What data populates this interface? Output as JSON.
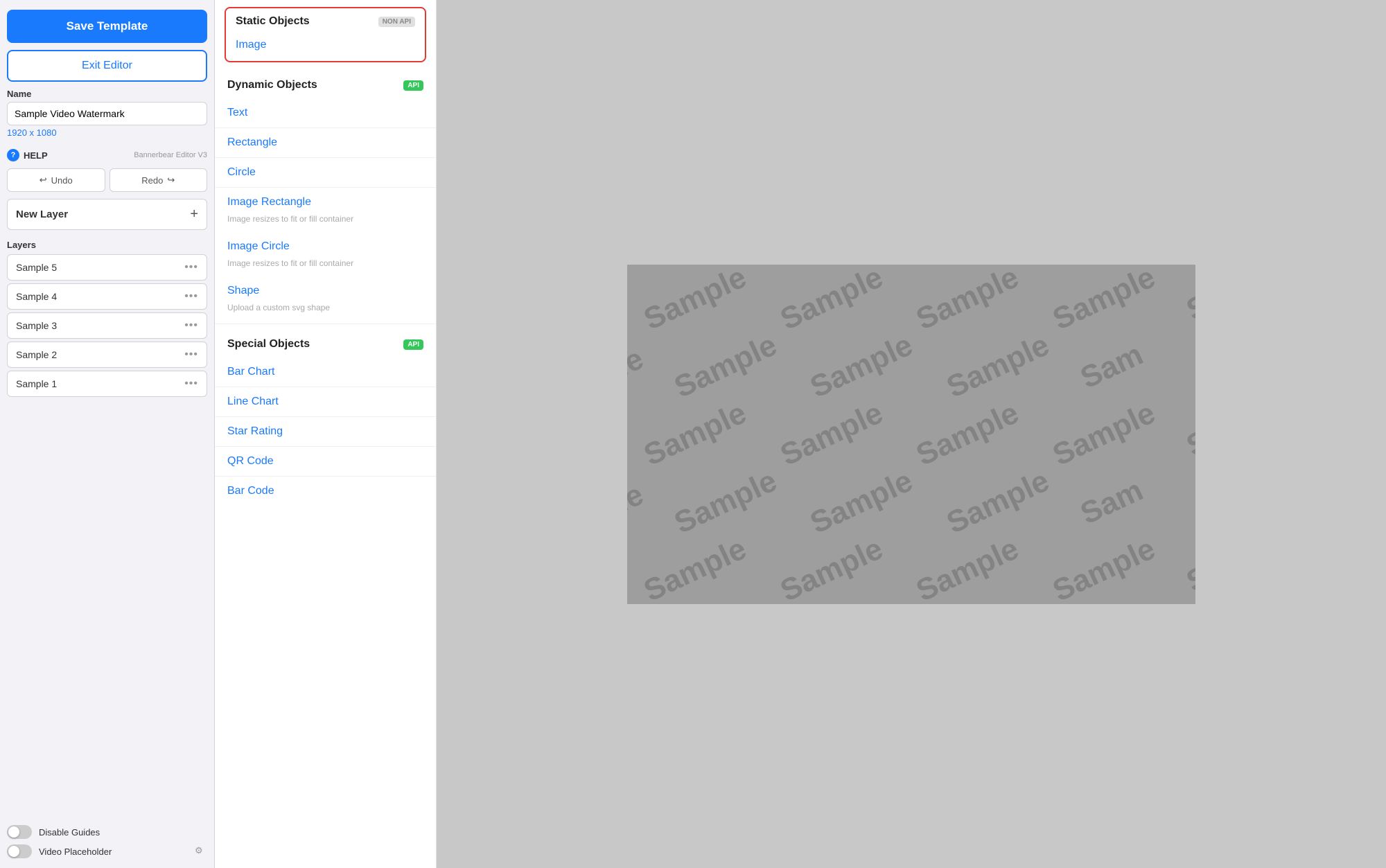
{
  "sidebar": {
    "save_button": "Save Template",
    "exit_button": "Exit Editor",
    "name_label": "Name",
    "name_value": "Sample Video Watermark",
    "dimensions": "1920 x 1080",
    "help_label": "HELP",
    "help_version": "Bannerbear Editor V3",
    "undo_label": "Undo",
    "redo_label": "Redo",
    "new_layer_label": "New Layer",
    "layers_label": "Layers",
    "layers": [
      {
        "name": "Sample 5"
      },
      {
        "name": "Sample 4"
      },
      {
        "name": "Sample 3"
      },
      {
        "name": "Sample 2"
      },
      {
        "name": "Sample 1"
      }
    ],
    "disable_guides": "Disable Guides",
    "video_placeholder": "Video Placeholder"
  },
  "object_panel": {
    "static_objects": {
      "title": "Static Objects",
      "badge": "NON API",
      "items": [
        {
          "label": "Image",
          "sub": null
        }
      ]
    },
    "dynamic_objects": {
      "title": "Dynamic Objects",
      "badge": "API",
      "items": [
        {
          "label": "Text",
          "sub": null
        },
        {
          "label": "Rectangle",
          "sub": null
        },
        {
          "label": "Circle",
          "sub": null
        },
        {
          "label": "Image Rectangle",
          "sub": "Image resizes to fit or fill container"
        },
        {
          "label": "Image Circle",
          "sub": "Image resizes to fit or fill container"
        },
        {
          "label": "Shape",
          "sub": "Upload a custom svg shape"
        }
      ]
    },
    "special_objects": {
      "title": "Special Objects",
      "badge": "API",
      "items": [
        {
          "label": "Bar Chart",
          "sub": null
        },
        {
          "label": "Line Chart",
          "sub": null
        },
        {
          "label": "Star Rating",
          "sub": null
        },
        {
          "label": "QR Code",
          "sub": null
        },
        {
          "label": "Bar Code",
          "sub": null
        }
      ]
    }
  },
  "canvas": {
    "watermark": "Sample"
  },
  "icons": {
    "undo_arrow": "↩",
    "redo_arrow": "↪",
    "plus": "+",
    "dots": "•••",
    "gear": "⚙",
    "help": "?"
  }
}
